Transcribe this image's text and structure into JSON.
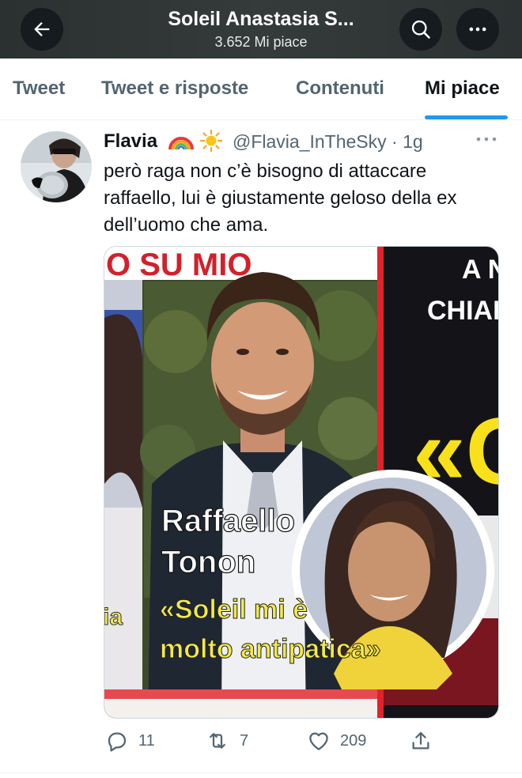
{
  "header": {
    "title": "Soleil Anastasia S...",
    "subtitle": "3.652 Mi piace",
    "background": "#2f3635"
  },
  "tabs": [
    {
      "label": "Tweet",
      "active": false
    },
    {
      "label": "Tweet e risposte",
      "active": false
    },
    {
      "label": "Contenuti",
      "active": false
    },
    {
      "label": "Mi piace",
      "active": true
    }
  ],
  "accent": "#1d9bf0",
  "tweet": {
    "author": "Flavia",
    "emojis": [
      "rainbow-emoji",
      "sun-emoji"
    ],
    "handle_time": "@Flavia_InTheSky · 1g",
    "text_lines": [
      "però raga non c’è bisogno di attaccare",
      "raffaello, lui è giustamente geloso della ex",
      "dell’uomo che ama."
    ],
    "media": {
      "headline_top": "O SU MIO",
      "right_top_1": "A N",
      "right_top_2": "CHIAR",
      "right_big": "«G",
      "caption_name_1": "Raffaello",
      "caption_name_2": "Tonon",
      "caption_quote_1": "«Soleil mi è",
      "caption_quote_2": "molto antipatica»",
      "left_fragment": "ia"
    },
    "actions": {
      "replies": "11",
      "retweets": "7",
      "likes": "209"
    }
  }
}
